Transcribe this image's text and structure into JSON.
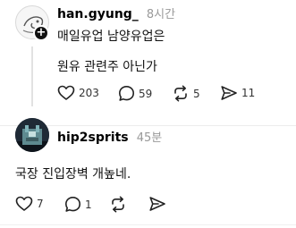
{
  "post": {
    "username": "han.gyung_",
    "time": "8시간",
    "line1": "매일유업 남양유업은",
    "line2": "원유 관련주 아닌가",
    "likes": "203",
    "comments": "59",
    "reposts": "5",
    "shares": "11"
  },
  "reply": {
    "username": "hip2sprits",
    "time": "45분",
    "text": "국장 진입장벽 개높네.",
    "likes": "7",
    "comments": "1"
  },
  "icons": {
    "like": "heart-icon",
    "comment": "comment-bubble-icon",
    "repost": "repost-icon",
    "share": "send-icon",
    "follow": "plus-icon"
  }
}
